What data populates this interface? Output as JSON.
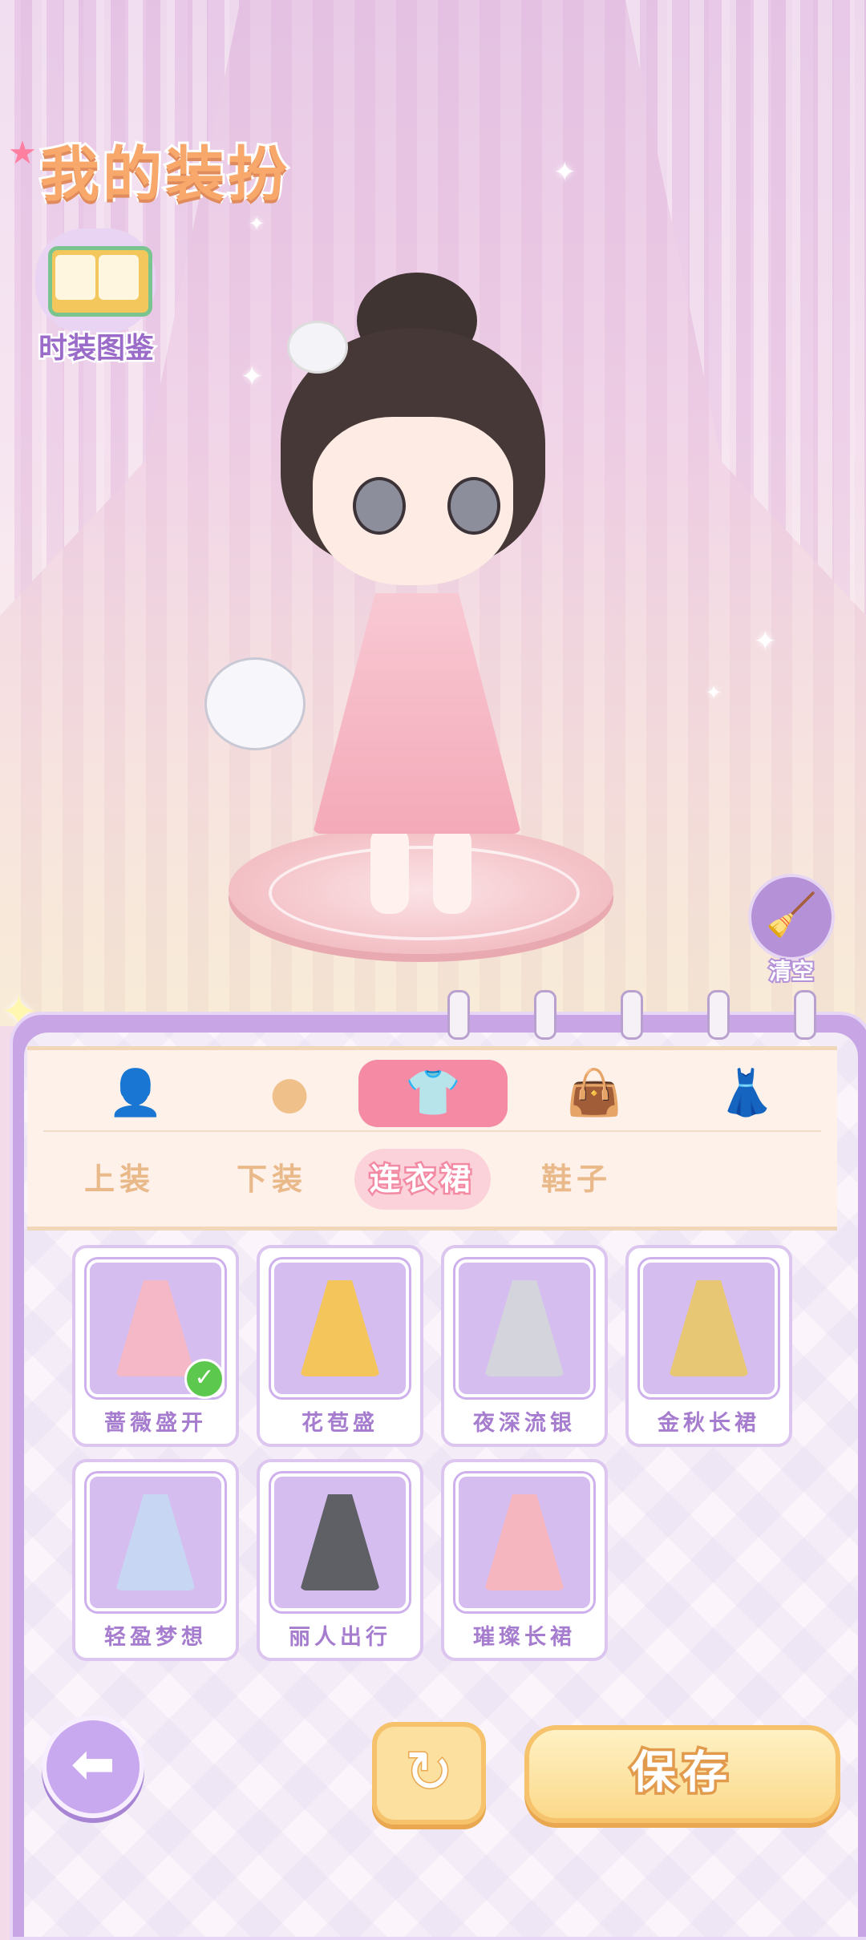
{
  "header": {
    "title": "我的装扮",
    "catalog_label": "时装图鉴"
  },
  "controls": {
    "clear_label": "清空",
    "save_label": "保存"
  },
  "tabs": {
    "categories": [
      {
        "name": "hair",
        "icon": "hair-silhouette-icon"
      },
      {
        "name": "face",
        "icon": "face-icon"
      },
      {
        "name": "clothing",
        "icon": "tshirt-icon",
        "active": true
      },
      {
        "name": "bag",
        "icon": "handbag-icon"
      },
      {
        "name": "accessory",
        "icon": "dress-stand-icon"
      }
    ],
    "sub_tabs": [
      "上装",
      "下装",
      "连衣裙",
      "鞋子"
    ],
    "active_sub_tab": "连衣裙"
  },
  "items": [
    {
      "label": "蔷薇盛开",
      "selected": true,
      "color": "#f4b8c6"
    },
    {
      "label": "花苞盛",
      "selected": false,
      "color": "#f3c55a"
    },
    {
      "label": "夜深流银",
      "selected": false,
      "color": "#d4d4dc"
    },
    {
      "label": "金秋长裙",
      "selected": false,
      "color": "#e8c774"
    },
    {
      "label": "轻盈梦想",
      "selected": false,
      "color": "#c7d6f3"
    },
    {
      "label": "丽人出行",
      "selected": false,
      "color": "#5f5f66"
    },
    {
      "label": "璀璨长裙",
      "selected": false,
      "color": "#f6b6bf"
    }
  ],
  "colors": {
    "accent_pink": "#f58aa4",
    "panel_purple": "#c8a6e6",
    "label_purple": "#a67ccf",
    "gold": "#f6c26b"
  }
}
